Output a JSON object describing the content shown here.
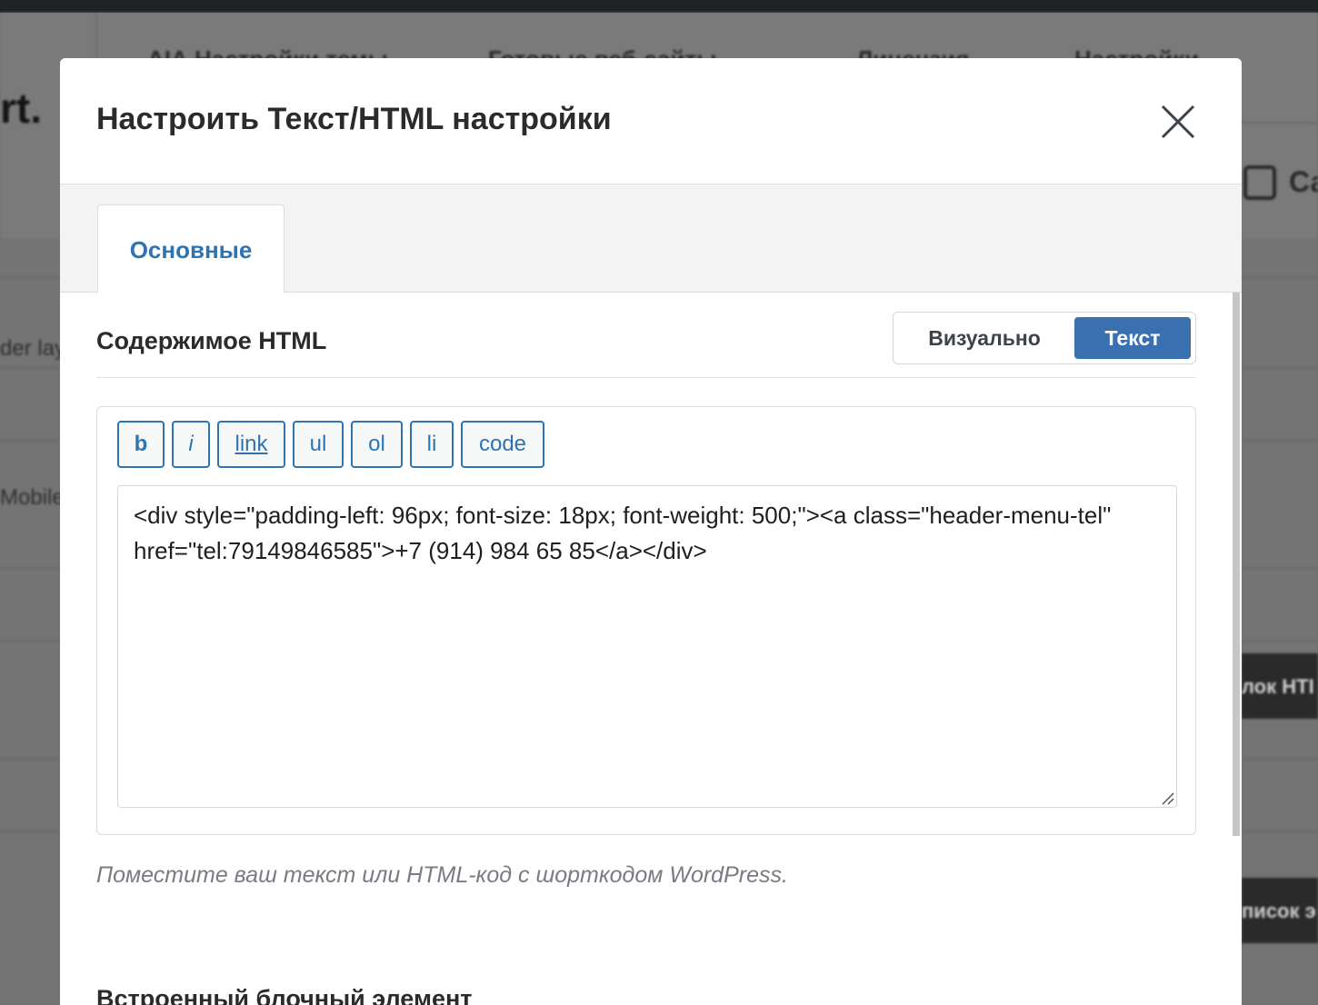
{
  "background": {
    "logo_fragment": "rt.",
    "nav_items": [
      "АІА Настройки темы",
      "Готовые веб-сайты",
      "Лицензия",
      "Настройки"
    ],
    "left_fragments": [
      "der lay",
      "Mobile"
    ],
    "right_fragments": [
      "Са",
      "лок HTI",
      "писок э"
    ]
  },
  "modal": {
    "title": "Настроить Текст/HTML настройки",
    "close_icon": "close-icon",
    "tabs": [
      {
        "label": "Основные",
        "active": true
      }
    ],
    "html_content": {
      "label": "Содержимое HTML",
      "mode_toggle": {
        "visual_label": "Визуально",
        "text_label": "Текст",
        "selected": "Текст"
      },
      "quicktags": [
        "b",
        "i",
        "link",
        "ul",
        "ol",
        "li",
        "code"
      ],
      "value": "<div style=\"padding-left: 96px; font-size: 18px; font-weight: 500;\"><a class=\"header-menu-tel\" href=\"tel:79149846585\">+7 (914) 984 65 85</a></div>",
      "help_text": "Поместите ваш текст или HTML-код с шорткодом WordPress."
    },
    "inline_block": {
      "label": "Встроенный блочный элемент"
    }
  },
  "colors": {
    "accent": "#2e74b1",
    "toggle_active": "#3a6fb0",
    "overlay": "#747474"
  }
}
